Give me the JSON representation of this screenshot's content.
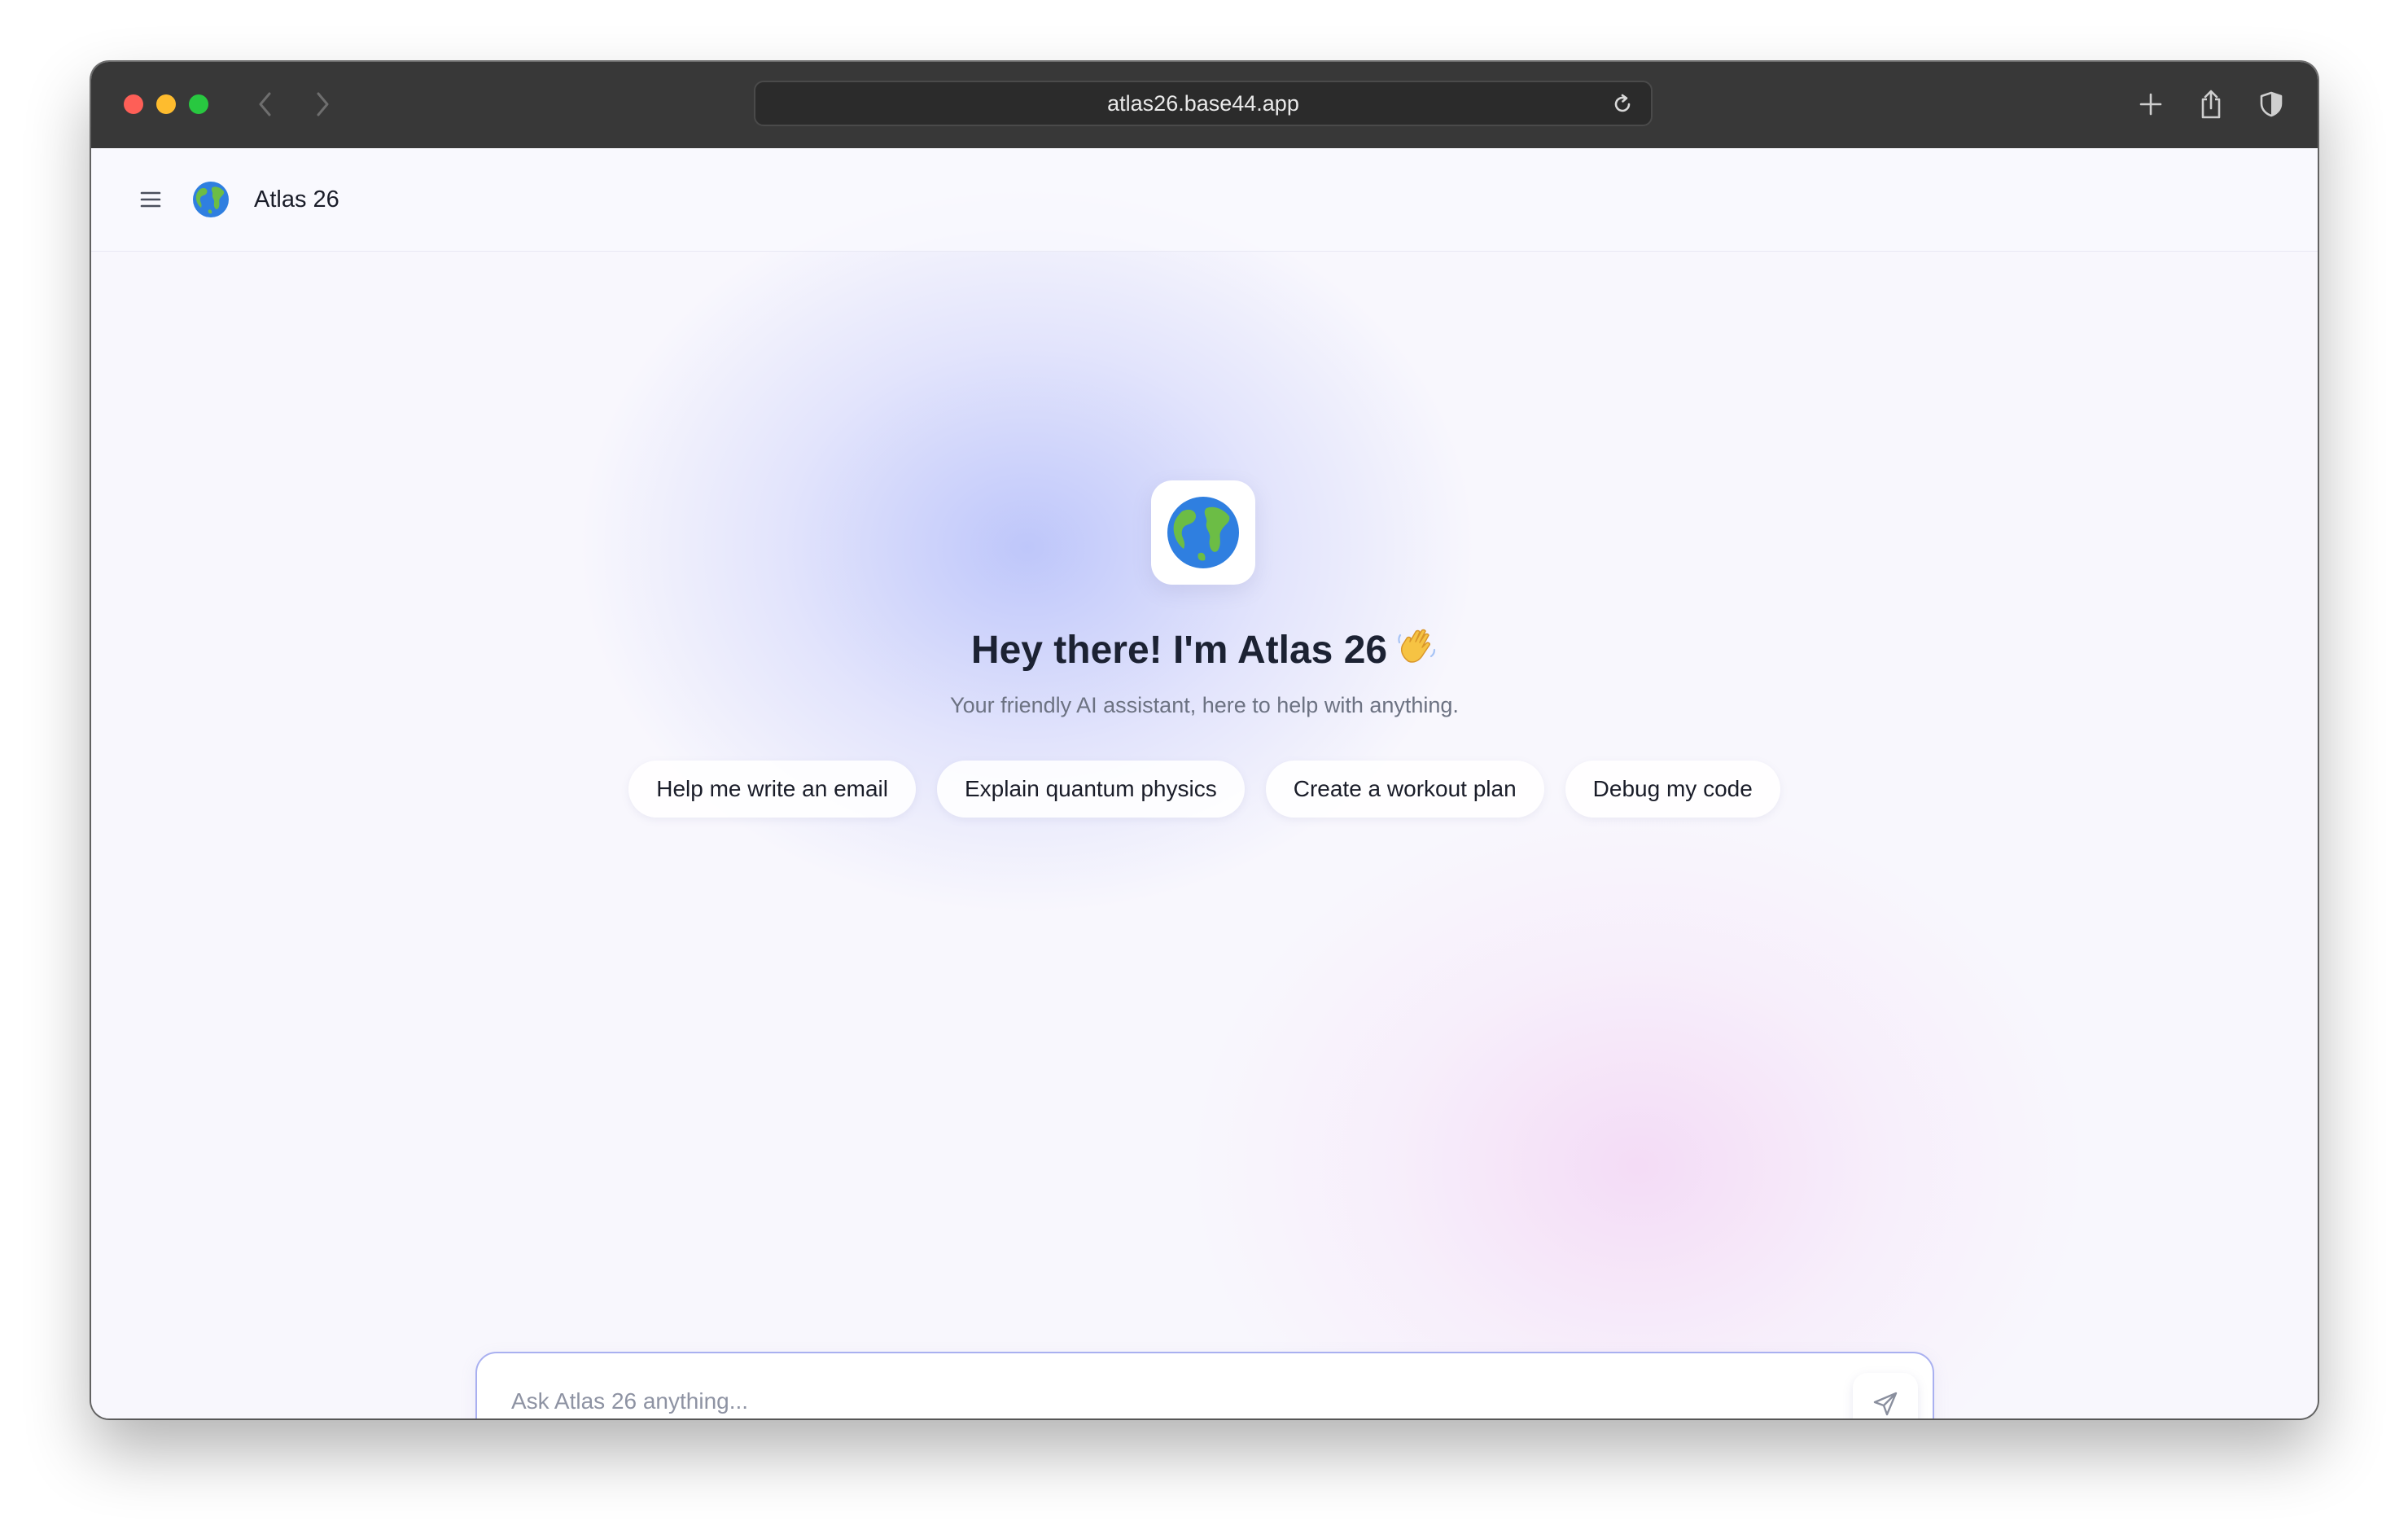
{
  "browser": {
    "url": "atlas26.base44.app",
    "icons": {
      "back": "chevron-left-icon",
      "forward": "chevron-right-icon",
      "reload": "reload-icon",
      "new_tab": "plus-icon",
      "share": "share-icon",
      "privacy": "shield-icon"
    }
  },
  "app": {
    "name": "Atlas 26",
    "logo": "globe-icon",
    "menu_icon": "hamburger-menu-icon"
  },
  "hero": {
    "title": "Hey there! I'm Atlas 26",
    "title_emoji": "waving-hand-icon",
    "subtitle": "Your friendly AI assistant, here to help with anything."
  },
  "suggestions": [
    {
      "label": "Help me write an email"
    },
    {
      "label": "Explain quantum physics"
    },
    {
      "label": "Create a workout plan"
    },
    {
      "label": "Debug my code"
    }
  ],
  "composer": {
    "placeholder": "Ask Atlas 26 anything...",
    "value": "",
    "send_icon": "send-icon"
  },
  "colors": {
    "titlebar": "#383838",
    "accent_border": "#a9b0f0",
    "text_primary": "#1a1d29",
    "text_secondary": "#6c7282"
  }
}
